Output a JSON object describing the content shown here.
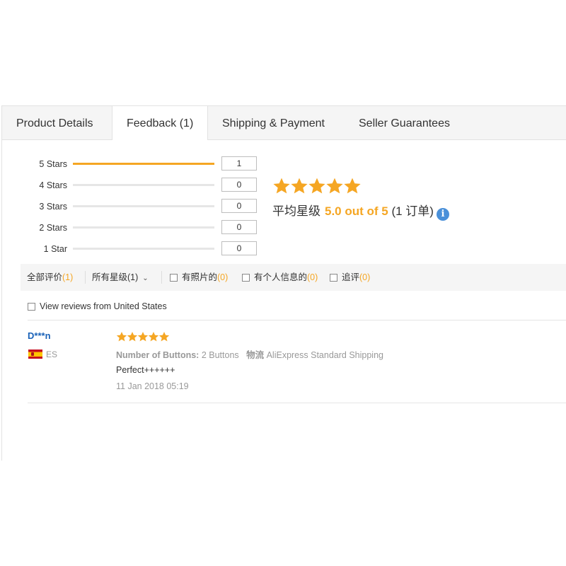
{
  "tabs": [
    {
      "label": "Product Details",
      "active": false
    },
    {
      "label": "Feedback (1)",
      "active": true
    },
    {
      "label": "Shipping & Payment",
      "active": false
    },
    {
      "label": "Seller Guarantees",
      "active": false
    }
  ],
  "rating_summary": {
    "histogram": [
      {
        "label": "5 Stars",
        "count": "1",
        "fraction": 1.0
      },
      {
        "label": "4 Stars",
        "count": "0",
        "fraction": 0
      },
      {
        "label": "3 Stars",
        "count": "0",
        "fraction": 0
      },
      {
        "label": "2 Stars",
        "count": "0",
        "fraction": 0
      },
      {
        "label": "1 Star",
        "count": "0",
        "fraction": 0
      }
    ],
    "stars": 5,
    "avg_label": "平均星级",
    "avg_score": "5.0 out of 5",
    "order_count": "(1 订单)",
    "info_icon": "i"
  },
  "filters": {
    "all": {
      "label": "全部评价",
      "count": "(1)"
    },
    "star_select": {
      "label": "所有星级",
      "count": "(1)"
    },
    "with_photos": {
      "label": "有照片的",
      "count": "(0)"
    },
    "with_personal_info": {
      "label": "有个人信息的",
      "count": "(0)"
    },
    "follow_up": {
      "label": "追评",
      "count": "(0)"
    },
    "us_reviews": "View reviews from United States"
  },
  "reviews": [
    {
      "name": "D***n",
      "country": "ES",
      "stars": 5,
      "option_key": "Number of Buttons:",
      "option_value": "2 Buttons",
      "shipping_key": "物流",
      "shipping_value": "AliExpress Standard Shipping",
      "text": "Perfect++++++",
      "date": "11 Jan 2018 05:19"
    }
  ],
  "colors": {
    "star": "#f5a623",
    "accent_count": "#f5a623",
    "link": "#1a62b8",
    "info": "#4a90d9"
  }
}
